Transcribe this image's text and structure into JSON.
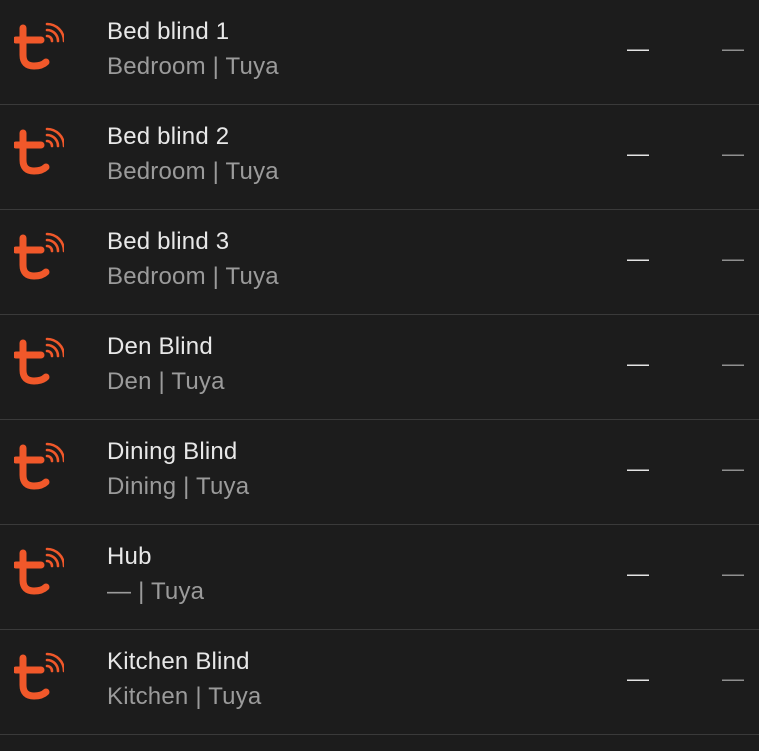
{
  "colors": {
    "background": "#1c1c1c",
    "divider": "#3a3a3a",
    "primary_text": "#e8e8e8",
    "secondary_text": "#9b9b9b",
    "brand_orange": "#f0582a"
  },
  "brand_icon": "tuya-logo-icon",
  "devices": [
    {
      "name": "Bed blind 1",
      "area": "Bedroom",
      "separator": "|",
      "integration": "Tuya",
      "col_a": "—",
      "col_b": "—"
    },
    {
      "name": "Bed blind 2",
      "area": "Bedroom",
      "separator": "|",
      "integration": "Tuya",
      "col_a": "—",
      "col_b": "—"
    },
    {
      "name": "Bed blind 3",
      "area": "Bedroom",
      "separator": "|",
      "integration": "Tuya",
      "col_a": "—",
      "col_b": "—"
    },
    {
      "name": "Den Blind",
      "area": "Den",
      "separator": "|",
      "integration": "Tuya",
      "col_a": "—",
      "col_b": "—"
    },
    {
      "name": "Dining Blind",
      "area": "Dining",
      "separator": "|",
      "integration": "Tuya",
      "col_a": "—",
      "col_b": "—"
    },
    {
      "name": "Hub",
      "area": "—",
      "separator": "|",
      "integration": "Tuya",
      "col_a": "—",
      "col_b": "—"
    },
    {
      "name": "Kitchen Blind",
      "area": "Kitchen",
      "separator": "|",
      "integration": "Tuya",
      "col_a": "—",
      "col_b": "—"
    }
  ]
}
